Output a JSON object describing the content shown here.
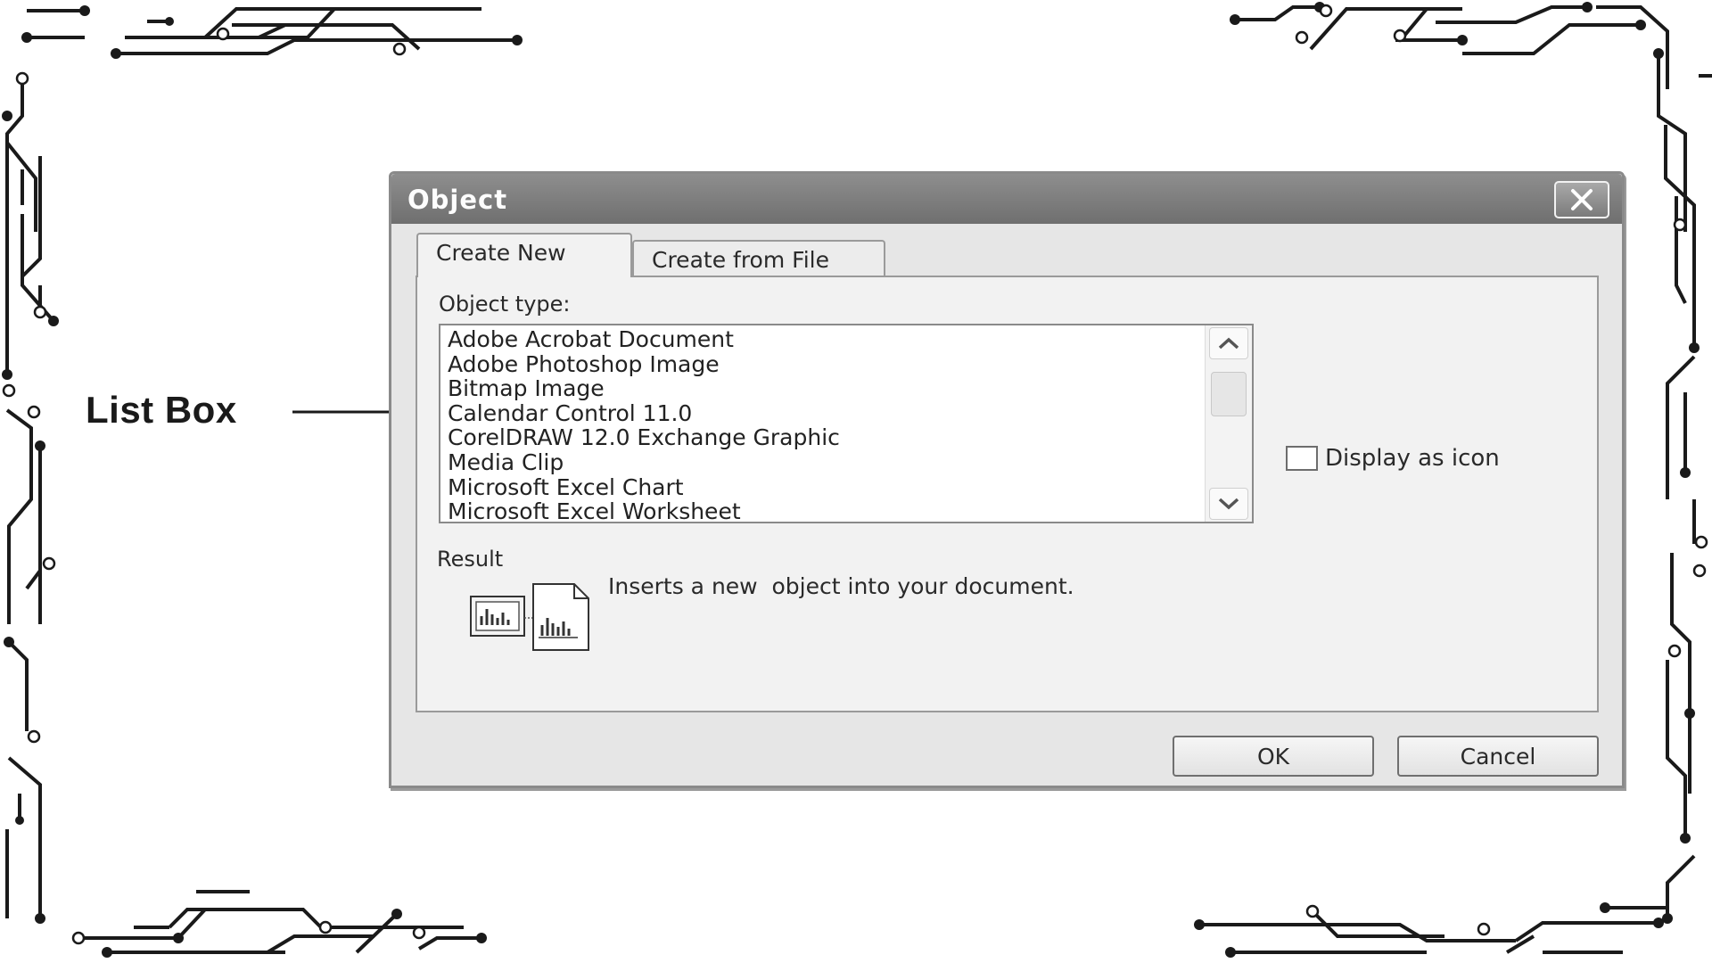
{
  "callout": {
    "label": "List Box"
  },
  "dialog": {
    "title": "Object",
    "close_icon": "close-icon",
    "tabs": [
      {
        "label": "Create New",
        "active": true
      },
      {
        "label": "Create from File",
        "active": false
      }
    ],
    "object_type_label": "Object type:",
    "list_items": [
      "Adobe Acrobat Document",
      "Adobe Photoshop Image",
      "Bitmap Image",
      "Calendar Control 11.0",
      "CorelDRAW 12.0 Exchange Graphic",
      "Media Clip",
      "Microsoft Excel Chart",
      "Microsoft Excel Worksheet"
    ],
    "display_as_icon": {
      "label": "Display as icon",
      "checked": false
    },
    "result_label": "Result",
    "result_text": "Inserts a new  object into your document.",
    "buttons": {
      "ok": "OK",
      "cancel": "Cancel"
    }
  },
  "colors": {
    "titlebar": "#7f7f7f",
    "dialog_bg": "#e6e6e6",
    "circuit": "#1a1a1a"
  }
}
